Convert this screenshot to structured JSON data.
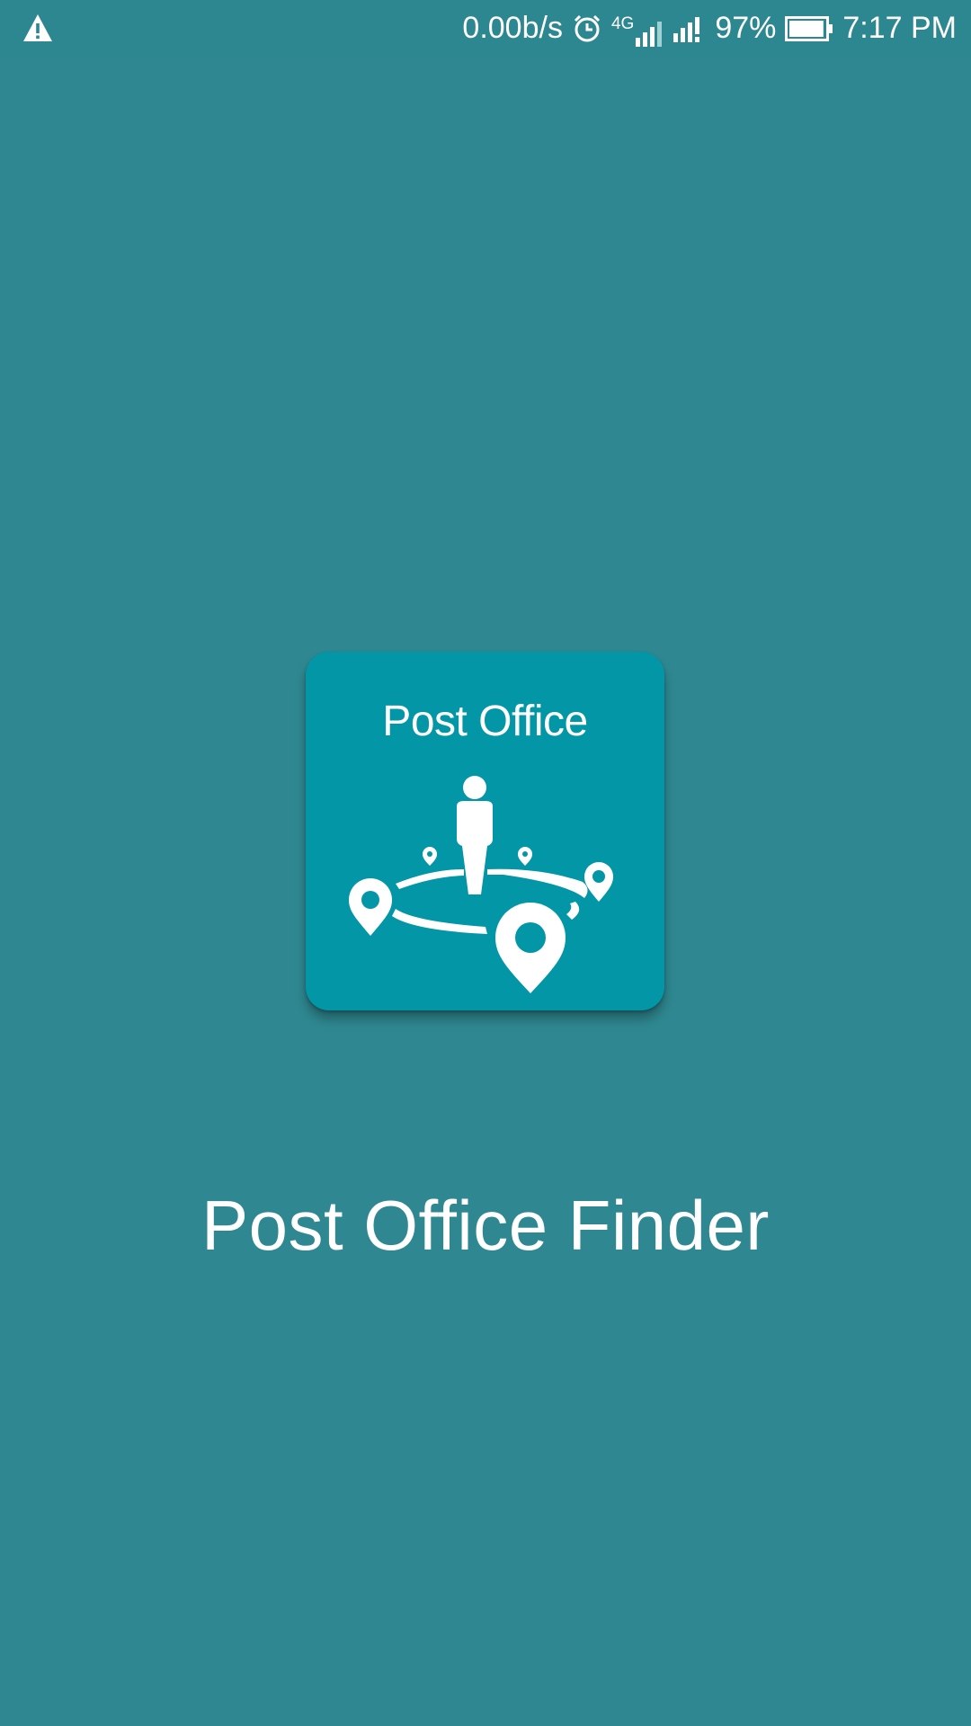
{
  "status_bar": {
    "warning_icon": "warning-icon",
    "network_speed": "0.00b/s",
    "alarm_icon": "alarm-icon",
    "network_type": "4G",
    "signal_icons": [
      "signal-4g-icon",
      "signal-icon"
    ],
    "battery_percent": "97%",
    "battery_level": 0.97,
    "time": "7:17 PM"
  },
  "splash": {
    "icon_caption": "Post Office",
    "icon_graphic": "person-location-pins-icon",
    "app_name": "Post Office Finder",
    "icon_color": "#0296a7",
    "background_color": "#2f8891"
  }
}
